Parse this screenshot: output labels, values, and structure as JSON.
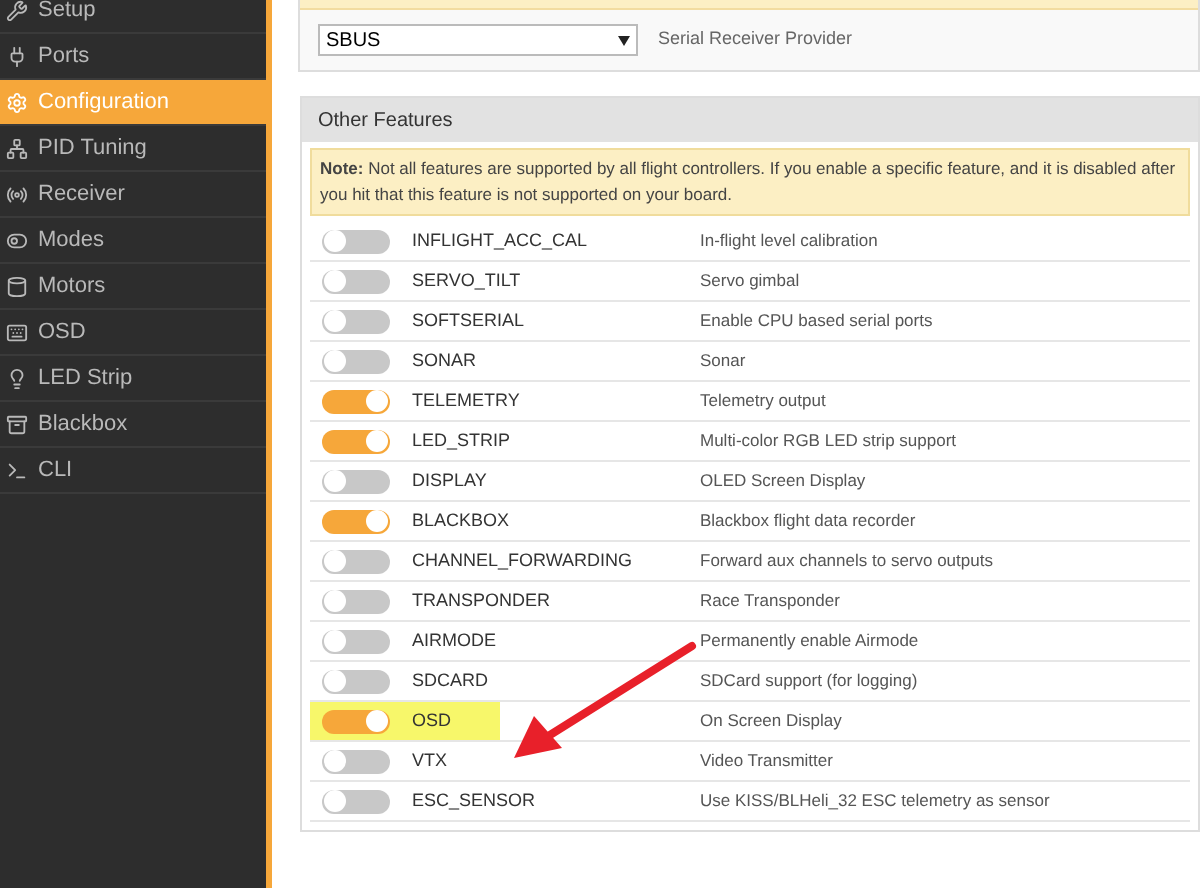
{
  "sidebar": {
    "items": [
      {
        "label": "Setup",
        "selected": false
      },
      {
        "label": "Ports",
        "selected": false
      },
      {
        "label": "Configuration",
        "selected": true
      },
      {
        "label": "PID Tuning",
        "selected": false
      },
      {
        "label": "Receiver",
        "selected": false
      },
      {
        "label": "Modes",
        "selected": false
      },
      {
        "label": "Motors",
        "selected": false
      },
      {
        "label": "OSD",
        "selected": false
      },
      {
        "label": "LED Strip",
        "selected": false
      },
      {
        "label": "Blackbox",
        "selected": false
      },
      {
        "label": "CLI",
        "selected": false
      }
    ]
  },
  "receiver_panel": {
    "provider_select": {
      "value": "SBUS"
    },
    "provider_label": "Serial Receiver Provider"
  },
  "features_panel": {
    "title": "Other Features",
    "note": "**Note:** Not all features are supported by all flight controllers. If you enable a specific feature, and it is disabled after you hit that this feature is not supported on your board.",
    "features": [
      {
        "name": "INFLIGHT_ACC_CAL",
        "description": "In-flight level calibration",
        "on": false,
        "highlighted": false
      },
      {
        "name": "SERVO_TILT",
        "description": "Servo gimbal",
        "on": false,
        "highlighted": false
      },
      {
        "name": "SOFTSERIAL",
        "description": "Enable CPU based serial ports",
        "on": false,
        "highlighted": false
      },
      {
        "name": "SONAR",
        "description": "Sonar",
        "on": false,
        "highlighted": false
      },
      {
        "name": "TELEMETRY",
        "description": "Telemetry output",
        "on": true,
        "highlighted": false
      },
      {
        "name": "LED_STRIP",
        "description": "Multi-color RGB LED strip support",
        "on": true,
        "highlighted": false
      },
      {
        "name": "DISPLAY",
        "description": "OLED Screen Display",
        "on": false,
        "highlighted": false
      },
      {
        "name": "BLACKBOX",
        "description": "Blackbox flight data recorder",
        "on": true,
        "highlighted": false
      },
      {
        "name": "CHANNEL_FORWARDING",
        "description": "Forward aux channels to servo outputs",
        "on": false,
        "highlighted": false
      },
      {
        "name": "TRANSPONDER",
        "description": "Race Transponder",
        "on": false,
        "highlighted": false
      },
      {
        "name": "AIRMODE",
        "description": "Permanently enable Airmode",
        "on": false,
        "highlighted": false
      },
      {
        "name": "SDCARD",
        "description": "SDCard support (for logging)",
        "on": false,
        "highlighted": false
      },
      {
        "name": "OSD",
        "description": "On Screen Display",
        "on": true,
        "highlighted": true
      },
      {
        "name": "VTX",
        "description": "Video Transmitter",
        "on": false,
        "highlighted": false
      },
      {
        "name": "ESC_SENSOR",
        "description": "Use KISS/BLHeli_32 ESC telemetry as sensor",
        "on": false,
        "highlighted": false
      }
    ]
  }
}
